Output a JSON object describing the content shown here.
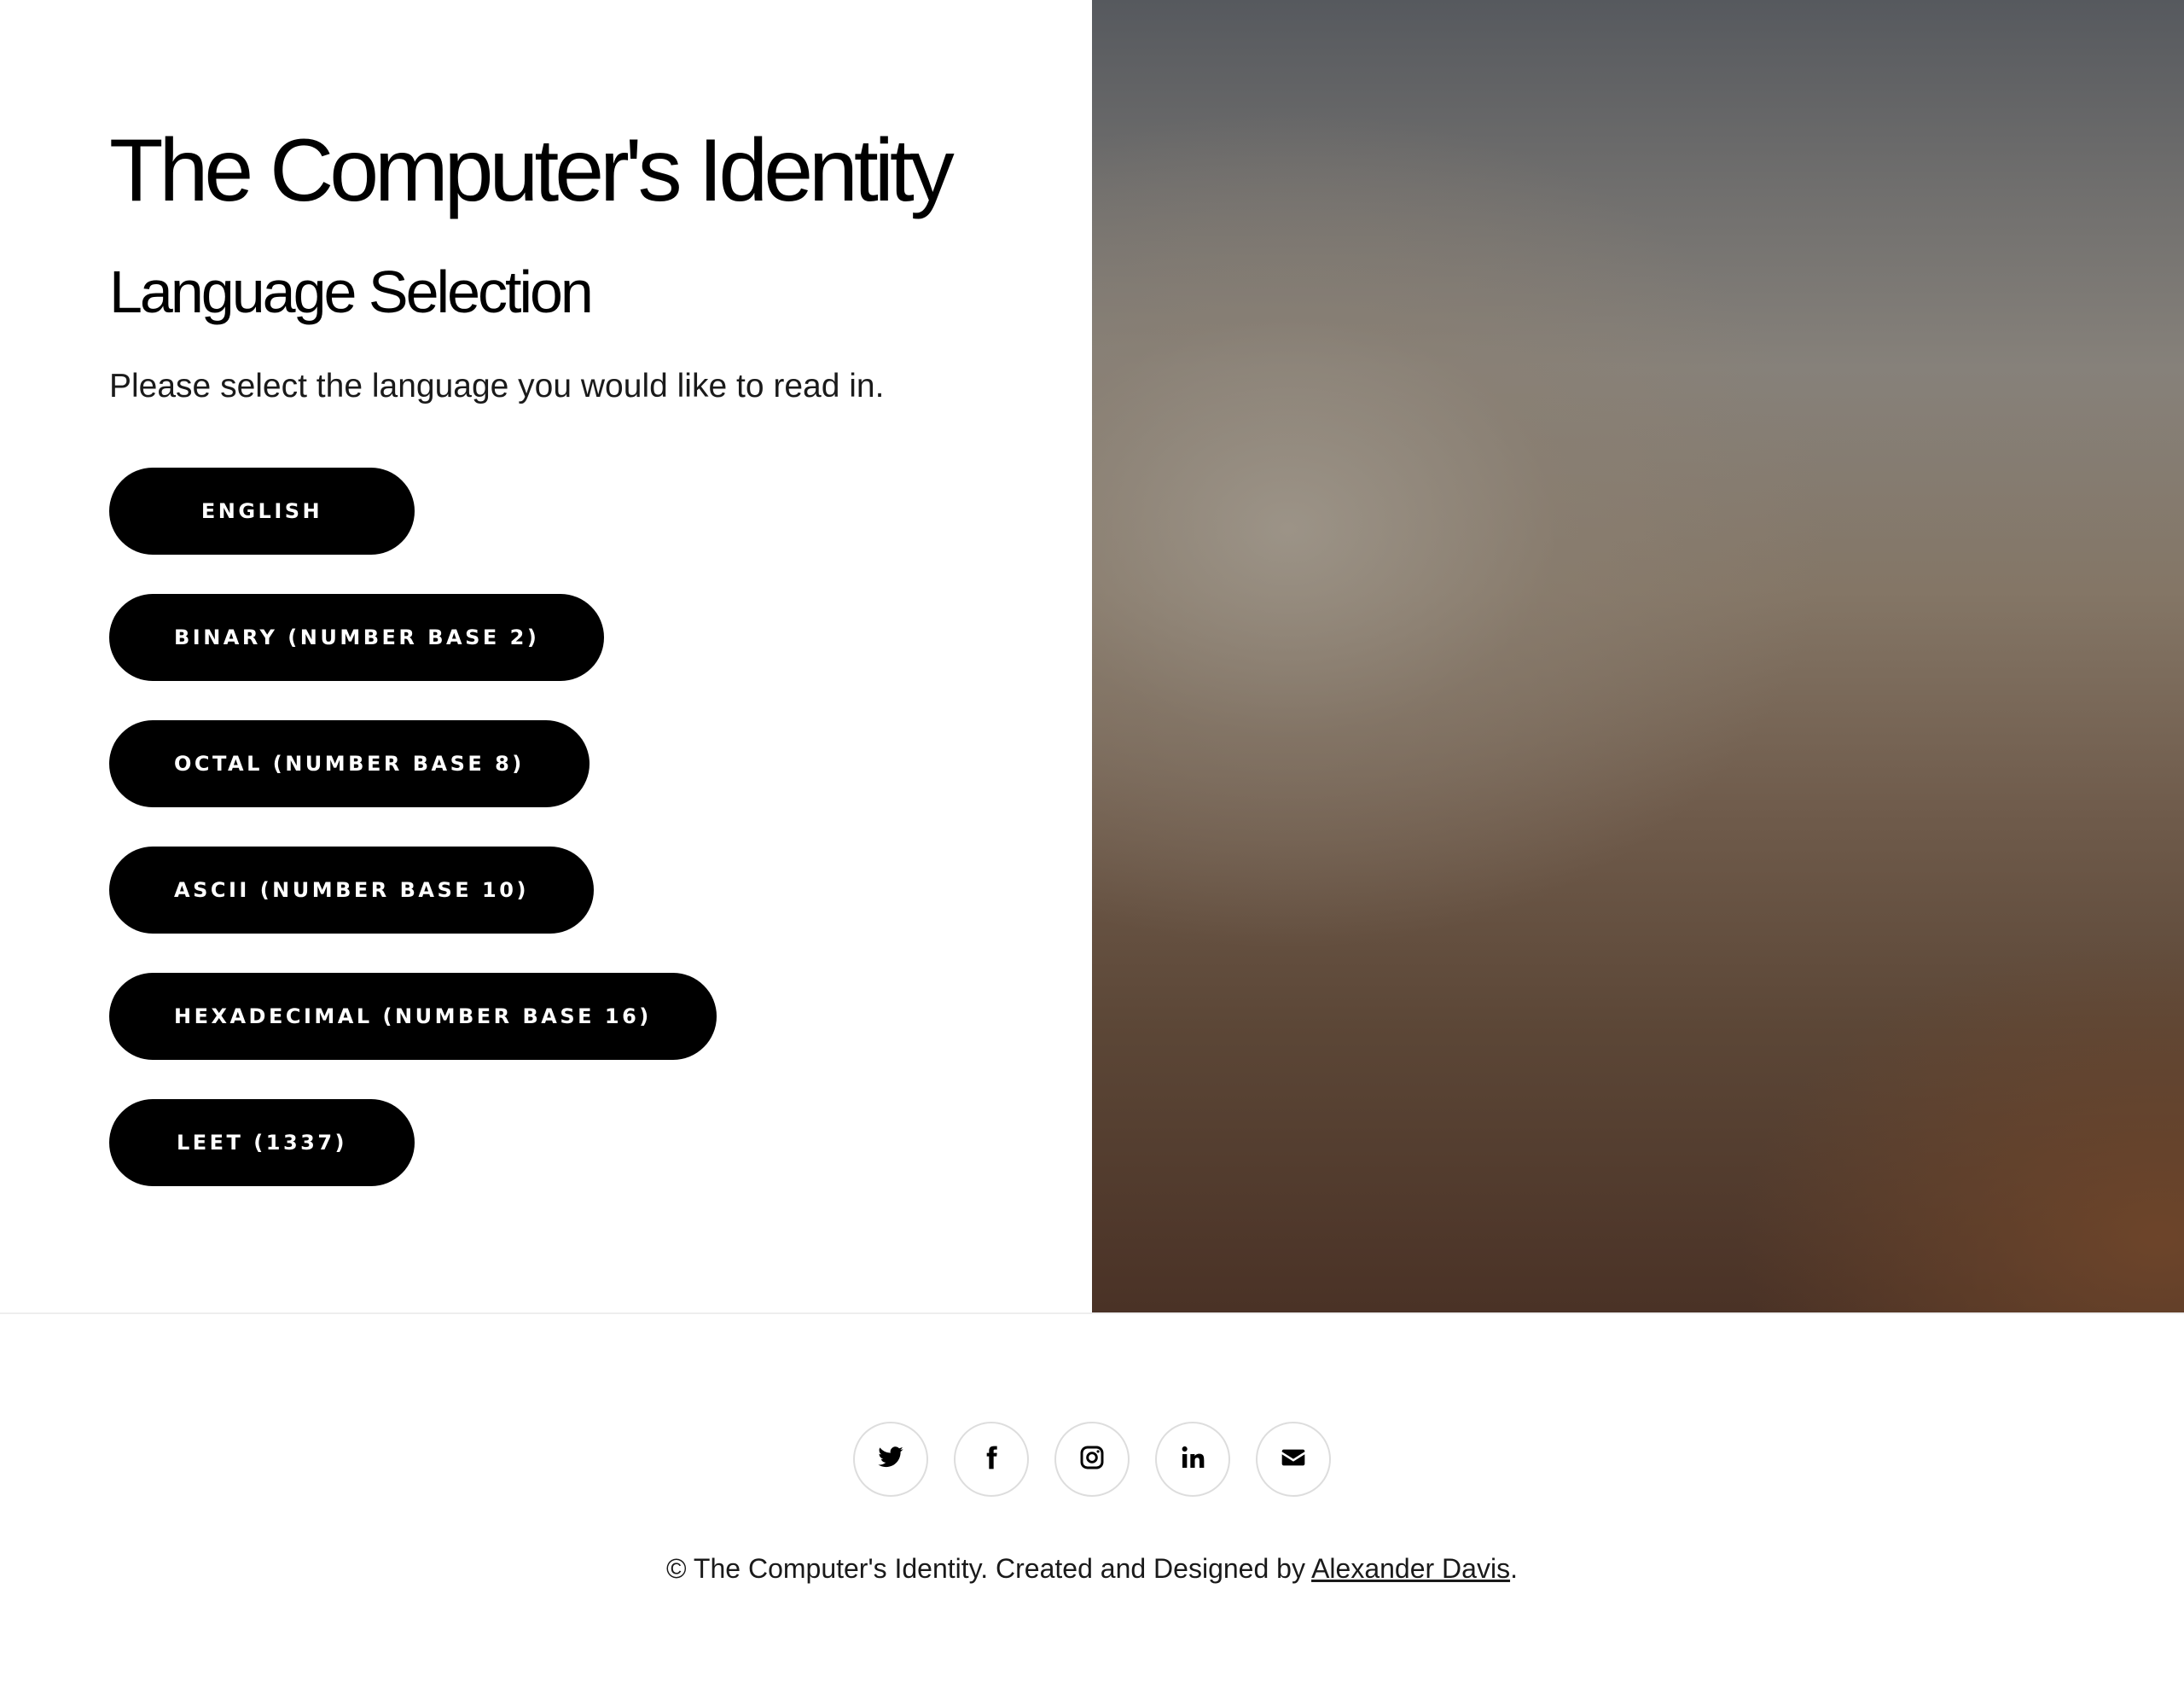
{
  "header": {
    "site_title": "The Computer's Identity",
    "section_title": "Language Selection",
    "intro": "Please select the language you would like to read in."
  },
  "languages": [
    {
      "label": "ENGLISH"
    },
    {
      "label": "BINARY (NUMBER BASE 2)"
    },
    {
      "label": "OCTAL (NUMBER BASE 8)"
    },
    {
      "label": "ASCII (NUMBER BASE 10)"
    },
    {
      "label": "HEXADECIMAL (NUMBER BASE 16)"
    },
    {
      "label": "LEET (1337)"
    }
  ],
  "footer": {
    "social_icons": [
      "twitter-icon",
      "facebook-icon",
      "instagram-icon",
      "linkedin-icon",
      "envelope-icon"
    ],
    "copyright_prefix": "© The Computer's Identity. Created and Designed by ",
    "author_link": "Alexander Davis",
    "copyright_suffix": "."
  },
  "colors": {
    "button_bg": "#000000",
    "button_text": "#ffffff",
    "background": "#ffffff"
  }
}
